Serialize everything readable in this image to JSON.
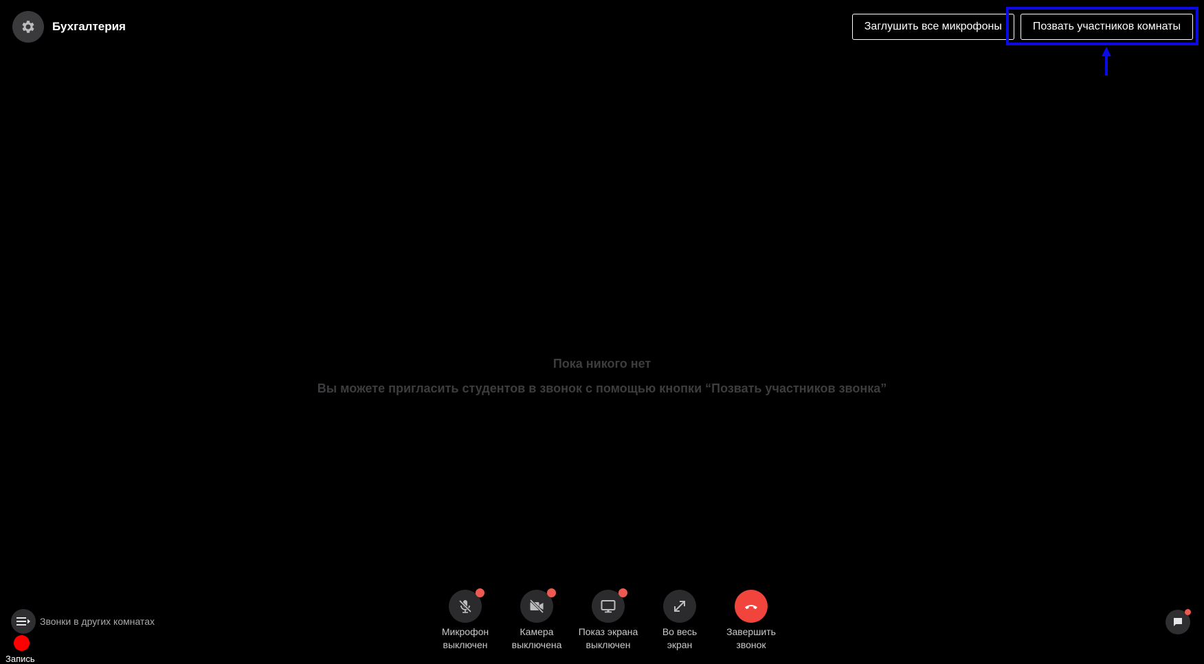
{
  "header": {
    "settings_icon": "gear-icon",
    "room_title": "Бухгалтерия"
  },
  "top_actions": {
    "mute_all_label": "Заглушить все микрофоны",
    "invite_label": "Позвать участников комнаты"
  },
  "empty_state": {
    "title": "Пока никого нет",
    "subtitle": "Вы можете пригласить студентов в звонок с помощью кнопки “Позвать участников звонка”"
  },
  "controls": {
    "microphone": {
      "icon": "mic-off-icon",
      "line1": "Микрофон",
      "line2": "выключен"
    },
    "camera": {
      "icon": "camera-off-icon",
      "line1": "Камера",
      "line2": "выключена"
    },
    "screen_share": {
      "icon": "monitor-icon",
      "line1": "Показ экрана",
      "line2": "выключен"
    },
    "fullscreen": {
      "icon": "expand-icon",
      "line1": "Во весь",
      "line2": "экран"
    },
    "end_call": {
      "icon": "hangup-icon",
      "line1": "Завершить",
      "line2": "звонок"
    }
  },
  "bottom_left": {
    "other_rooms_icon": "list-icon",
    "other_rooms_label": "Звонки в других комнатах",
    "record_label": "Запись"
  },
  "bottom_right": {
    "chat_icon": "chat-icon"
  },
  "colors": {
    "background": "#000000",
    "annotation": "#0a0ae6",
    "end_call": "#f0443c",
    "badge": "#ee5a52",
    "record": "#ff0000",
    "empty_text": "#3d3d40"
  }
}
